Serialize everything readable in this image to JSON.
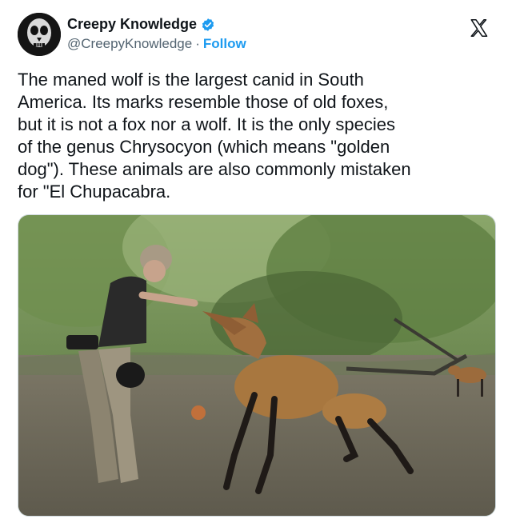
{
  "account": {
    "display_name": "Creepy Knowledge",
    "handle": "@CreepyKnowledge",
    "separator": "·",
    "follow_label": "Follow",
    "verified": true
  },
  "tweet": {
    "text": "The maned wolf is the largest canid in South\nAmerica. Its marks resemble those of old foxes,\nbut it is not a fox nor a wolf. It is the only species\nof the genus Chrysocyon (which means \"golden\ndog\"). These animals are also commonly mistaken\nfor \"El Chupacabra."
  },
  "icons": {
    "verified": "verified-badge-icon",
    "platform": "x-logo-icon"
  },
  "colors": {
    "accent": "#1d9bf0",
    "text": "#0f1419",
    "secondary": "#536471"
  }
}
